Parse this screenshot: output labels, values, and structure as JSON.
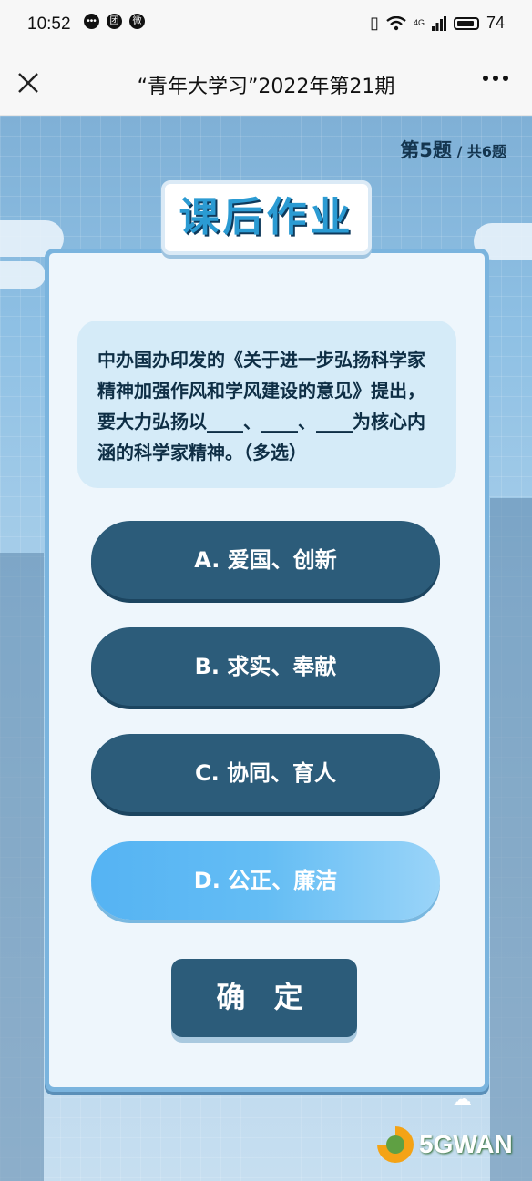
{
  "status_bar": {
    "time": "10:52",
    "battery": "74",
    "network": "4G"
  },
  "nav": {
    "title": "“青年大学习”2022年第21期"
  },
  "progress": {
    "current": "第5题",
    "total": " / 共6题"
  },
  "card": {
    "tab_title": "课后作业",
    "question": "中办国办印发的《关于进一步弘扬科学家精神加强作风和学风建设的意见》提出，要大力弘扬以____、____、____为核心内涵的科学家精神。（多选）",
    "options": [
      {
        "label": "A. 爱国、创新",
        "selected": false
      },
      {
        "label": "B. 求实、奉献",
        "selected": false
      },
      {
        "label": "C. 协同、育人",
        "selected": false
      },
      {
        "label": "D. 公正、廉洁",
        "selected": true
      }
    ],
    "confirm_label": "确 定"
  },
  "watermark": {
    "text": "5GWAN"
  },
  "colors": {
    "option_bg": "#2c5c7a",
    "option_selected": "#5db8f3",
    "question_bg": "#d5ebf8",
    "card_border": "#7ab4de"
  }
}
